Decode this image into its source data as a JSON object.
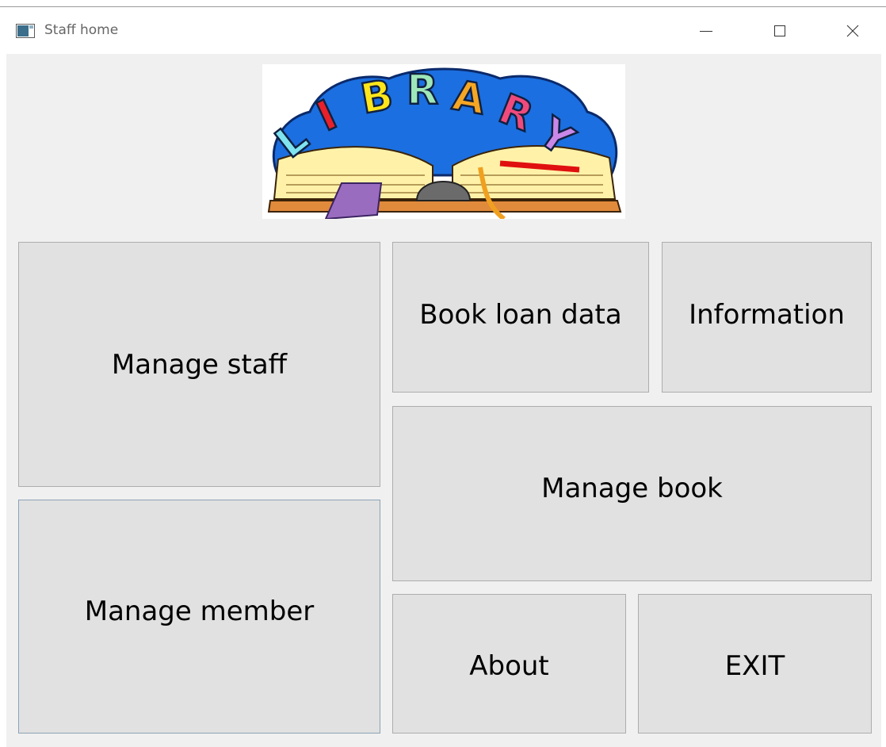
{
  "window": {
    "title": "Staff home",
    "icon": "app-window-icon",
    "controls": [
      "minimize-icon",
      "maximize-icon",
      "close-icon"
    ]
  },
  "logo": {
    "letters": [
      "L",
      "I",
      "B",
      "R",
      "A",
      "R",
      "Y"
    ],
    "letter_colors": [
      "#7fe3f0",
      "#e8202a",
      "#ffe61a",
      "#9ee7b9",
      "#f5a623",
      "#f04a7c",
      "#c987e8"
    ],
    "background_color": "#1b6fe0"
  },
  "buttons": {
    "manage_staff": "Manage staff",
    "manage_member": "Manage member",
    "book_loan_data": "Book loan data",
    "information": "Information",
    "manage_book": "Manage book",
    "about": "About",
    "exit": "EXIT"
  },
  "colors": {
    "button_face": "#e1e1e1",
    "button_border": "#adadad",
    "client_background": "#f0f0f0"
  }
}
